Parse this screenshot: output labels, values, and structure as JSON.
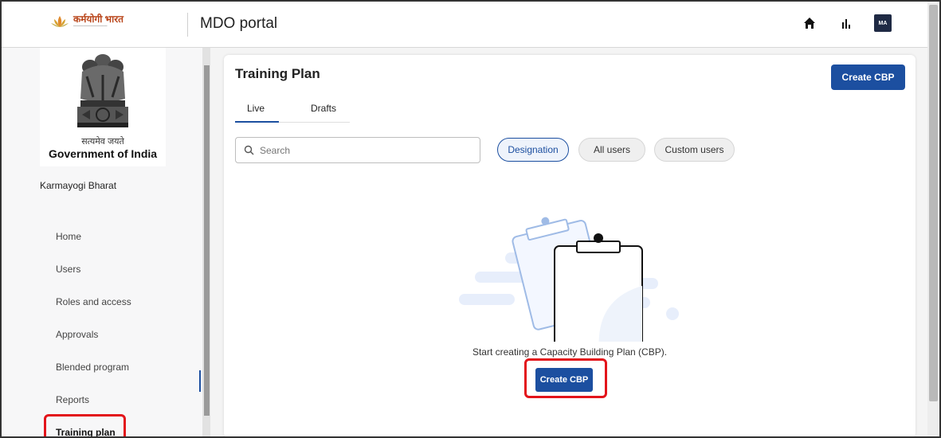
{
  "topbar": {
    "brand_text": "कर्मयोगी भारत",
    "portal_title": "MDO portal",
    "avatar_initials": "MA",
    "icons": [
      "home-icon",
      "analytics-icon"
    ]
  },
  "sidebar": {
    "gov_motto": "सत्यमेव जयते",
    "gov_name": "Government of India",
    "org_name": "Karmayogi Bharat",
    "items": [
      {
        "label": "Home"
      },
      {
        "label": "Users"
      },
      {
        "label": "Roles and access"
      },
      {
        "label": "Approvals"
      },
      {
        "label": "Blended program"
      },
      {
        "label": "Reports"
      },
      {
        "label": "Training plan",
        "active": true
      }
    ]
  },
  "main": {
    "title": "Training Plan",
    "create_button": "Create CBP",
    "tabs": [
      {
        "label": "Live",
        "active": true
      },
      {
        "label": "Drafts"
      }
    ],
    "search": {
      "placeholder": "Search",
      "value": ""
    },
    "filters": [
      {
        "label": "Designation",
        "selected": true
      },
      {
        "label": "All users"
      },
      {
        "label": "Custom users"
      }
    ],
    "empty_message": "Start creating a Capacity Building Plan (CBP).",
    "empty_create_button": "Create CBP"
  },
  "colors": {
    "accent": "#1c4fa0",
    "highlight": "#e3141b"
  }
}
